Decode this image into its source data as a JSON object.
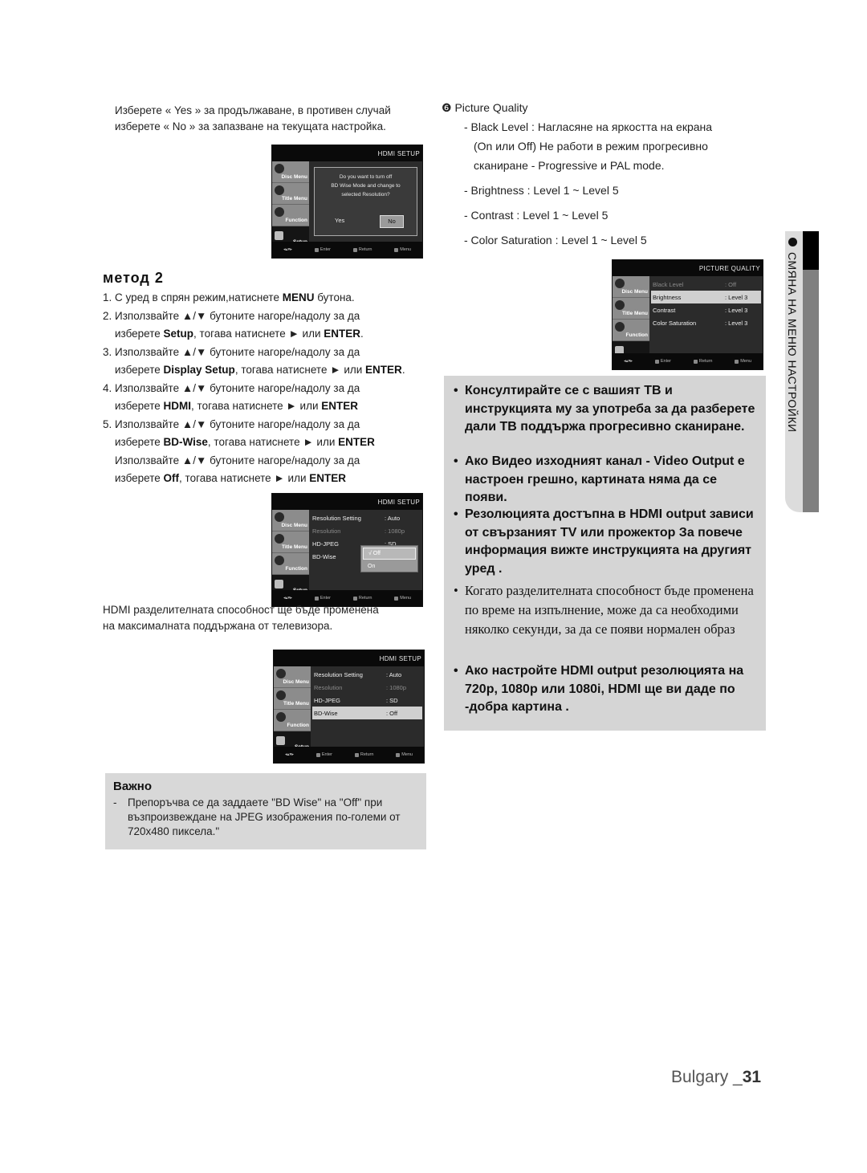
{
  "left": {
    "intro": [
      "Изберете « Yes » за продължаване, в противен случай",
      "изберете « No » за запазване на текущата настройка."
    ],
    "method_title": "метод 2",
    "steps": [
      {
        "pre": "1. С уред в спрян режим,натиснете ",
        "bold": "MENU",
        "post": " бутона."
      },
      {
        "pre": "2. Използвайте ▲/▼ бутоните нагоре/надолу за да",
        "bold": "",
        "post": ""
      },
      {
        "pre": "изберете ",
        "bold": "Setup",
        "post": ", тогава натиснете  ► или ",
        "bold2": "ENTER",
        "post2": "."
      },
      {
        "pre": "3. Използвайте ▲/▼ бутоните нагоре/надолу за да",
        "bold": "",
        "post": ""
      },
      {
        "pre": "изберете ",
        "bold": "Display Setup",
        "post": ", тогава натиснете  ► или  ",
        "bold2": "ENTER",
        "post2": "."
      },
      {
        "pre": "4. Използвайте ▲/▼ бутоните нагоре/надолу за да",
        "bold": "",
        "post": ""
      },
      {
        "pre": "изберете ",
        "bold": "HDMI",
        "post": ", тогава натиснете  ► или  ",
        "bold2": "ENTER",
        "post2": ""
      },
      {
        "pre": "5. Използвайте ▲/▼ бутоните нагоре/надолу за да",
        "bold": "",
        "post": ""
      },
      {
        "pre": "изберете ",
        "bold": "BD-Wise",
        "post": ", тогава натиснете  ► или  ",
        "bold2": "ENTER",
        "post2": ""
      },
      {
        "pre": "Използвайте ▲/▼ бутоните нагоре/надолу за да",
        "bold": "",
        "post": ""
      },
      {
        "pre": "изберете ",
        "bold": "Off",
        "post": ", тогава натиснете  ► или  ",
        "bold2": "ENTER",
        "post2": ""
      }
    ],
    "note": [
      "HDMI разделителната способност ще бъде променена",
      "на максималната поддържана от телевизора."
    ],
    "important": {
      "heading": "Важно",
      "dash": "-",
      "text": "Препоръчва се да заддаете \"BD Wise\" на \"Off\" при възпроизвеждане на JPEG изображения по-големи от 720x480 пиксела.\""
    }
  },
  "osd_common": {
    "side": [
      "Disc Menu",
      "Title Menu",
      "Function",
      "Setup"
    ],
    "footer": [
      "Enter",
      "Return",
      "Menu"
    ]
  },
  "osd1": {
    "title": "HDMI SETUP",
    "message": [
      "Do you want to turn off",
      "BD Wise Mode and change to",
      "selected Resolution?"
    ],
    "yes": "Yes",
    "no": "No"
  },
  "osd2": {
    "title": "HDMI SETUP",
    "rows": [
      {
        "k": "Resolution Setting",
        "v": ": Auto"
      },
      {
        "k": "Resolution",
        "v": ": 1080p"
      },
      {
        "k": "HD-JPEG",
        "v": ": SD"
      },
      {
        "k": "BD-Wise",
        "v": ""
      }
    ],
    "options": [
      "√  Off",
      "On"
    ]
  },
  "osd3": {
    "title": "HDMI SETUP",
    "rows": [
      {
        "k": "Resolution Setting",
        "v": ": Auto"
      },
      {
        "k": "Resolution",
        "v": ": 1080p"
      },
      {
        "k": "HD-JPEG",
        "v": ": SD"
      },
      {
        "k": "BD-Wise",
        "v": ": Off"
      }
    ]
  },
  "osd4": {
    "title": "PICTURE QUALITY",
    "rows": [
      {
        "k": "Black Level",
        "v": ": Off"
      },
      {
        "k": "Brightness",
        "v": ": Level 3"
      },
      {
        "k": "Contrast",
        "v": ": Level 3"
      },
      {
        "k": "Color Saturation",
        "v": ": Level 3"
      }
    ]
  },
  "right": {
    "pq_title": "❻ Picture Quality",
    "pq_lines": [
      "- Black Level : Нагласяне на яркостта на екрана",
      "(On или Off) Не работи в режим прогресивно",
      "сканиране - Progressive и PAL mode.",
      "- Brightness : Level 1 ~ Level 5",
      "- Contrast : Level 1 ~ Level 5",
      "- Color Saturation : Level 1 ~ Level 5"
    ],
    "tips": [
      "Консултирайте се с вашият ТВ и инструкцията му за употреба за да разберете дали ТВ поддържа прогресивно сканиране.",
      "Ако Видео изходният канал  - Video Output е настроен грешно, картината няма да се появи.",
      "Резолюцията достъпна в HDMI output зависи от свързаният TV или прожектор За повече информация вижте инструкцията на другият уред .",
      "Когато разделителната способност бъде променена по време на изпълнение, може да са необходими няколко секунди, за да се появи нормален образ",
      "Ако настройте HDMI output резолюцията на 720p, 1080p или 1080i, HDMI ще ви даде по -добра картина ."
    ],
    "bullet": "•",
    "side_tab": "СМЯНА НА МЕНЮ НАСТРОЙКИ"
  },
  "page": {
    "country": "Bulgary _",
    "number": "31"
  }
}
